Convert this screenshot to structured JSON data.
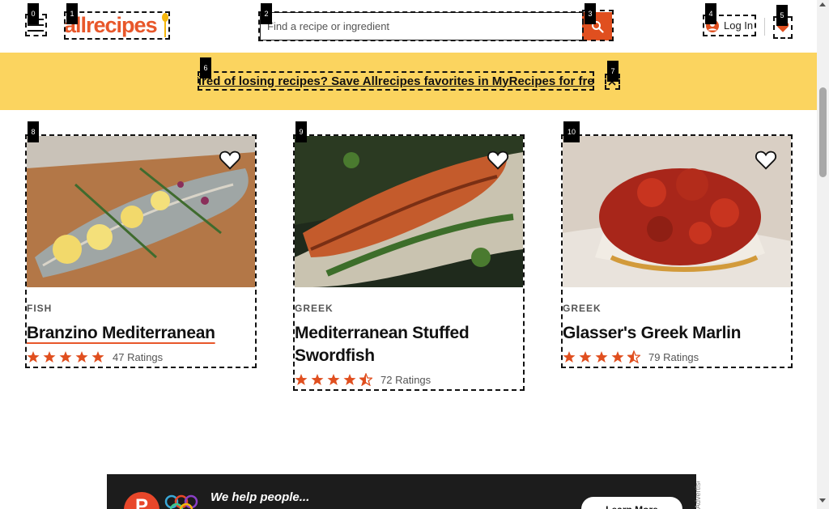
{
  "header": {
    "logo_text": "allrecipes",
    "search": {
      "placeholder": "Find a recipe or ingredient",
      "value": ""
    },
    "login_label": "Log In"
  },
  "banner": {
    "text": "Tired of losing recipes? Save Allrecipes favorites in MyRecipes for free"
  },
  "cards": [
    {
      "tag": "FISH",
      "title": "Branzino Mediterranean",
      "ratings": "47 Ratings",
      "stars": 5
    },
    {
      "tag": "GREEK",
      "title": "Mediterranean Stuffed Swordfish",
      "ratings": "72 Ratings",
      "stars": 4.5
    },
    {
      "tag": "GREEK",
      "title": "Glasser's Greek Marlin",
      "ratings": "79 Ratings",
      "stars": 4.5
    }
  ],
  "ad": {
    "tagline": "We help people...",
    "button_label": "Learn More",
    "side_label": "Advertisement"
  },
  "markers": [
    "0",
    "1",
    "2",
    "3",
    "4",
    "5",
    "6",
    "7",
    "8",
    "9",
    "10"
  ],
  "colors": {
    "brand": "#e8572a",
    "banner": "#fbd45f",
    "star": "#e04f1f",
    "search_button": "#e04f1f"
  }
}
